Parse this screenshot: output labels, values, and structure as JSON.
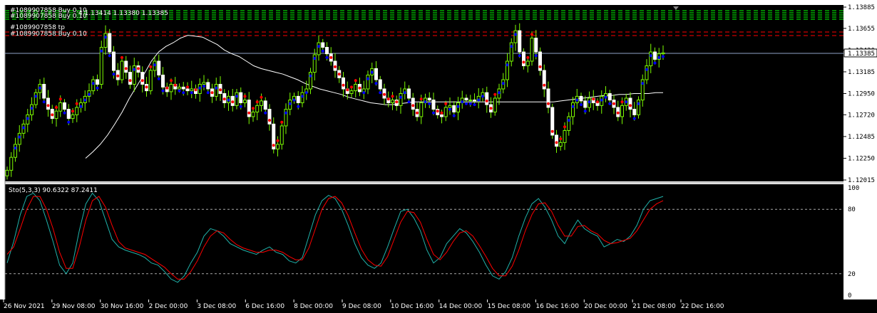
{
  "main_header": {
    "line1": "#1089907858 Buy 0.10",
    "line2": "#1089907858 Buy 0.10",
    "ohlc": "4 1.13414 1.13380 1.13385",
    "trade_tp": "#1089907858 tp",
    "trade_buy": "#1089907858 Buy 0.10"
  },
  "colors": {
    "background": "#000000",
    "grid": "#2a2a2a",
    "bull": "#7cfc00",
    "bear": "#ffffff",
    "ma": "#ffffff",
    "psar_up": "#0000ff",
    "psar_down": "#ff0000",
    "stoch_main": "#20b2aa",
    "stoch_signal": "#ff0000",
    "order_line": "#00ff00",
    "tp_line": "#ff0000",
    "price_line": "#8fa4c8"
  },
  "chart_data": [
    {
      "type": "candlestick",
      "ylim": [
        1.12015,
        1.13885
      ],
      "y_ticks": [
        "1.13885",
        "1.13655",
        "1.13420",
        "1.13185",
        "1.12950",
        "1.12720",
        "1.12485",
        "1.12250",
        "1.12015"
      ],
      "current_price": "1.13385",
      "current_value": 1.13385,
      "x_labels": [
        "26 Nov 2021",
        "29 Nov 08:00",
        "30 Nov 16:00",
        "2 Dec 00:00",
        "3 Dec 08:00",
        "6 Dec 16:00",
        "8 Dec 00:00",
        "9 Dec 08:00",
        "10 Dec 16:00",
        "14 Dec 00:00",
        "15 Dec 08:00",
        "16 Dec 16:00",
        "20 Dec 00:00",
        "21 Dec 08:00",
        "22 Dec 16:00"
      ],
      "closes": [
        1.1212,
        1.1226,
        1.124,
        1.1252,
        1.1262,
        1.1272,
        1.1283,
        1.1296,
        1.1305,
        1.129,
        1.1278,
        1.1268,
        1.1276,
        1.1285,
        1.1278,
        1.1268,
        1.1272,
        1.128,
        1.1285,
        1.1292,
        1.1298,
        1.131,
        1.1305,
        1.1345,
        1.136,
        1.134,
        1.132,
        1.131,
        1.133,
        1.1318,
        1.1305,
        1.1325,
        1.1318,
        1.1305,
        1.1298,
        1.132,
        1.133,
        1.1315,
        1.1302,
        1.1297,
        1.1305,
        1.13,
        1.1302,
        1.13,
        1.1298,
        1.13,
        1.1295,
        1.1305,
        1.1307,
        1.13,
        1.1292,
        1.1305,
        1.1295,
        1.1285,
        1.1292,
        1.1282,
        1.1296,
        1.1285,
        1.1288,
        1.127,
        1.1275,
        1.1282,
        1.1287,
        1.1278,
        1.1262,
        1.1235,
        1.124,
        1.126,
        1.1278,
        1.1288,
        1.1292,
        1.1285,
        1.1296,
        1.13,
        1.1318,
        1.1337,
        1.135,
        1.1345,
        1.1338,
        1.133,
        1.132,
        1.1312,
        1.13,
        1.1295,
        1.1298,
        1.1305,
        1.1297,
        1.13,
        1.1315,
        1.1322,
        1.131,
        1.13,
        1.129,
        1.1285,
        1.1288,
        1.1282,
        1.1295,
        1.13,
        1.129,
        1.1278,
        1.127,
        1.1285,
        1.129,
        1.1288,
        1.1278,
        1.1272,
        1.127,
        1.128,
        1.1282,
        1.1275,
        1.1285,
        1.129,
        1.1288,
        1.1288,
        1.1287,
        1.1292,
        1.1296,
        1.1283,
        1.1275,
        1.129,
        1.13,
        1.131,
        1.133,
        1.135,
        1.1363,
        1.134,
        1.1325,
        1.133,
        1.1355,
        1.134,
        1.132,
        1.13,
        1.128,
        1.125,
        1.1238,
        1.1242,
        1.1255,
        1.127,
        1.1285,
        1.1292,
        1.1287,
        1.128,
        1.129,
        1.1285,
        1.1282,
        1.1292,
        1.1295,
        1.1288,
        1.128,
        1.127,
        1.1282,
        1.129,
        1.1278,
        1.1272,
        1.1288,
        1.131,
        1.1325,
        1.134,
        1.1332,
        1.1338,
        1.1339
      ],
      "ma_values": [
        1.1225,
        1.1232,
        1.124,
        1.125,
        1.1262,
        1.1275,
        1.129,
        1.1303,
        1.1316,
        1.133,
        1.134,
        1.1346,
        1.135,
        1.1355,
        1.1358,
        1.1357,
        1.1356,
        1.1352,
        1.1348,
        1.1342,
        1.1338,
        1.1335,
        1.133,
        1.1325,
        1.1322,
        1.132,
        1.1318,
        1.1316,
        1.1313,
        1.131,
        1.1306,
        1.1303,
        1.13,
        1.1298,
        1.1296,
        1.1294,
        1.1291,
        1.1289,
        1.1287,
        1.1285,
        1.1284,
        1.1283,
        1.1283,
        1.1284,
        1.1285,
        1.1286,
        1.1286,
        1.1286,
        1.1286,
        1.1286,
        1.1286,
        1.1286,
        1.1286,
        1.1286,
        1.1286,
        1.1286,
        1.1286,
        1.1286,
        1.1286,
        1.1286,
        1.1286,
        1.1286,
        1.1286,
        1.1286,
        1.1286,
        1.1287,
        1.1288,
        1.1289,
        1.129,
        1.1291,
        1.1292,
        1.1293,
        1.1293,
        1.1294,
        1.1294,
        1.1295,
        1.1295,
        1.1295,
        1.1296,
        1.1296
      ]
    },
    {
      "type": "line",
      "title": "Sto(5,3,3) 90.6322 87.2411",
      "ylim": [
        0,
        100
      ],
      "y_ticks": [
        100,
        80,
        20,
        0
      ],
      "levels": [
        80,
        20
      ],
      "series": [
        {
          "values": [
            30,
            50,
            75,
            92,
            95,
            88,
            70,
            50,
            28,
            20,
            30,
            60,
            85,
            95,
            88,
            70,
            52,
            45,
            42,
            40,
            38,
            35,
            30,
            28,
            22,
            15,
            12,
            18,
            30,
            40,
            55,
            62,
            60,
            55,
            48,
            45,
            42,
            40,
            38,
            42,
            45,
            40,
            38,
            32,
            30,
            35,
            55,
            75,
            88,
            93,
            90,
            80,
            65,
            48,
            35,
            28,
            25,
            30,
            45,
            62,
            78,
            80,
            72,
            60,
            42,
            30,
            35,
            48,
            55,
            62,
            58,
            50,
            40,
            28,
            18,
            15,
            22,
            35,
            55,
            72,
            85,
            90,
            82,
            70,
            55,
            48,
            60,
            70,
            62,
            58,
            55,
            45,
            48,
            52,
            50,
            55,
            65,
            80,
            88,
            90,
            92
          ]
        },
        {
          "values": [
            38,
            45,
            62,
            80,
            92,
            92,
            80,
            62,
            40,
            25,
            25,
            45,
            70,
            88,
            92,
            82,
            65,
            50,
            44,
            42,
            40,
            38,
            34,
            30,
            26,
            20,
            15,
            15,
            22,
            32,
            45,
            55,
            60,
            58,
            52,
            47,
            44,
            42,
            40,
            40,
            42,
            42,
            40,
            36,
            33,
            33,
            44,
            62,
            80,
            90,
            92,
            86,
            74,
            58,
            43,
            33,
            28,
            27,
            36,
            52,
            68,
            78,
            77,
            68,
            52,
            38,
            33,
            40,
            50,
            58,
            60,
            55,
            46,
            36,
            25,
            18,
            18,
            27,
            42,
            60,
            75,
            85,
            86,
            78,
            65,
            55,
            55,
            64,
            65,
            60,
            57,
            51,
            48,
            49,
            51,
            53,
            60,
            70,
            80,
            85,
            88
          ]
        }
      ]
    }
  ]
}
